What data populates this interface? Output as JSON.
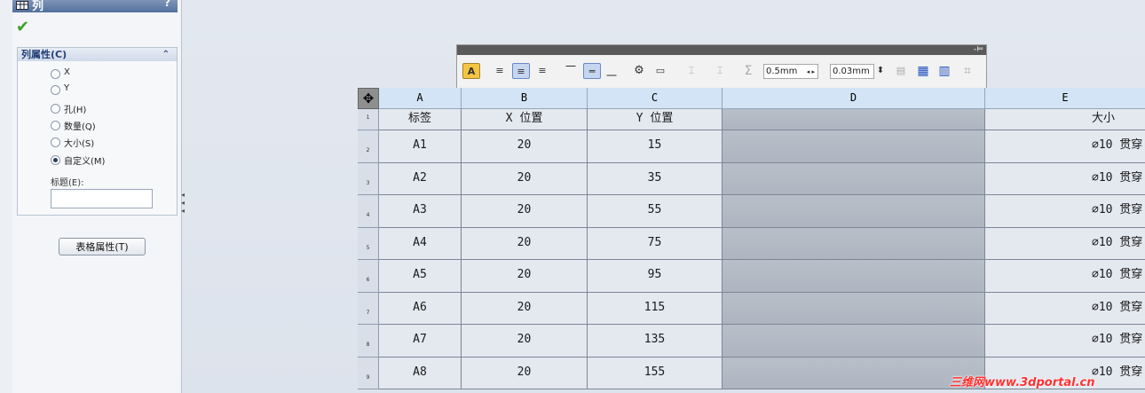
{
  "panel": {
    "title": "列",
    "help": "?",
    "ok_glyph": "✔",
    "group_title": "列属性(C)",
    "collapse_glyph": "⌃",
    "options": [
      {
        "label": "X",
        "selected": false
      },
      {
        "label": "Y",
        "selected": false
      },
      {
        "label": "孔(H)",
        "selected": false
      },
      {
        "label": "数量(Q)",
        "selected": false
      },
      {
        "label": "大小(S)",
        "selected": false
      },
      {
        "label": "自定义(M)",
        "selected": true
      }
    ],
    "title_field_label": "标题(E):",
    "title_field_value": "",
    "table_props_button": "表格属性(T)"
  },
  "toolbar": {
    "pin_glyph": "-⊨",
    "font_btn": "A",
    "align_left": "≡",
    "align_center": "≡",
    "align_right": "≡",
    "valign_top": "⎺",
    "valign_mid": "═",
    "valign_bottom": "⎽",
    "link_btn": "⚙",
    "text_btn": "▭",
    "insert_above": "⌶",
    "insert_below": "⌶",
    "sum_btn": "Σ",
    "border_width": "0.5mm",
    "cell_padding": "0.03mm",
    "stepper": "⬍",
    "props_btn": "▤",
    "table_btn": "▦",
    "grid_btn": "▥",
    "split_btn": "⌗"
  },
  "table": {
    "move_handle": "✥",
    "columns": [
      "A",
      "B",
      "C",
      "D",
      "E"
    ],
    "header_row": {
      "num": "1",
      "cells": [
        "标签",
        "X 位置",
        "Y 位置",
        "",
        "大小"
      ]
    },
    "rows": [
      {
        "num": "2",
        "cells": [
          "A1",
          "20",
          "15",
          "",
          "∅10 贯穿"
        ]
      },
      {
        "num": "3",
        "cells": [
          "A2",
          "20",
          "35",
          "",
          "∅10 贯穿"
        ]
      },
      {
        "num": "4",
        "cells": [
          "A3",
          "20",
          "55",
          "",
          "∅10 贯穿"
        ]
      },
      {
        "num": "5",
        "cells": [
          "A4",
          "20",
          "75",
          "",
          "∅10 贯穿"
        ]
      },
      {
        "num": "6",
        "cells": [
          "A5",
          "20",
          "95",
          "",
          "∅10 贯穿"
        ]
      },
      {
        "num": "7",
        "cells": [
          "A6",
          "20",
          "115",
          "",
          "∅10 贯穿"
        ]
      },
      {
        "num": "8",
        "cells": [
          "A7",
          "20",
          "135",
          "",
          "∅10 贯穿"
        ]
      },
      {
        "num": "9",
        "cells": [
          "A8",
          "20",
          "155",
          "",
          "∅10 贯穿"
        ]
      }
    ]
  },
  "watermark": "三维网www.3dportal.cn"
}
